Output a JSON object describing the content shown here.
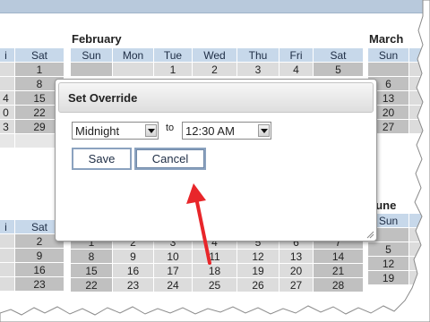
{
  "calendar": {
    "left_partial": {
      "headers": [
        "i",
        "Sat"
      ],
      "rows_top": [
        [
          "",
          "1"
        ],
        [
          "",
          "8"
        ],
        [
          "4",
          "15"
        ],
        [
          "0",
          "22"
        ],
        [
          "3",
          "29"
        ]
      ],
      "rows_bottom": [
        [
          "",
          "2"
        ],
        [
          "",
          "9"
        ],
        [
          "",
          "16"
        ],
        [
          "",
          "23"
        ]
      ]
    },
    "february": {
      "name": "February",
      "days": [
        "Sun",
        "Mon",
        "Tue",
        "Wed",
        "Thu",
        "Fri",
        "Sat"
      ],
      "row1": [
        "",
        "",
        "1",
        "2",
        "3",
        "4",
        "5"
      ]
    },
    "may_partial": {
      "rows": [
        [
          "1",
          "2",
          "3",
          "4",
          "5",
          "6",
          "7"
        ],
        [
          "8",
          "9",
          "10",
          "11",
          "12",
          "13",
          "14"
        ],
        [
          "15",
          "16",
          "17",
          "18",
          "19",
          "20",
          "21"
        ],
        [
          "22",
          "23",
          "24",
          "25",
          "26",
          "27",
          "28"
        ]
      ]
    },
    "march": {
      "name": "March",
      "days": [
        "Sun"
      ],
      "rows": [
        "",
        "6",
        "13",
        "20",
        "27"
      ]
    },
    "june": {
      "name": "June",
      "days": [
        "Sun"
      ],
      "rows": [
        "",
        "5",
        "12",
        "19"
      ]
    }
  },
  "dialog": {
    "title": "Set Override",
    "from_value": "Midnight",
    "to_label": "to",
    "to_value": "12:30 AM",
    "save_label": "Save",
    "cancel_label": "Cancel"
  },
  "colors": {
    "header_cell": "#c7d8ea",
    "weekend_cell": "#c0c0c0",
    "weekday_cell": "#dcdcdc",
    "button_border": "#8ba2bf",
    "arrow": "#e8262a"
  }
}
